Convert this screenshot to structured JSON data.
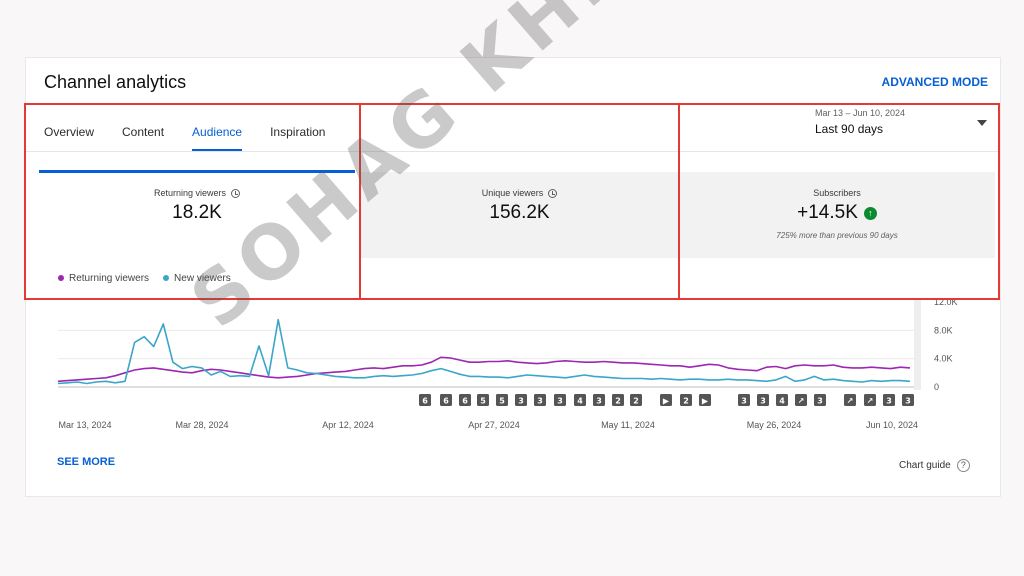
{
  "header": {
    "title": "Channel analytics",
    "advanced_mode": "ADVANCED MODE"
  },
  "tabs": [
    {
      "label": "Overview"
    },
    {
      "label": "Content"
    },
    {
      "label": "Audience",
      "active": true
    },
    {
      "label": "Inspiration"
    }
  ],
  "date_range": {
    "range": "Mar 13 – Jun 10, 2024",
    "label": "Last 90 days"
  },
  "metrics": {
    "returning": {
      "label": "Returning viewers",
      "value": "18.2K"
    },
    "unique": {
      "label": "Unique viewers",
      "value": "156.2K"
    },
    "subscribers": {
      "label": "Subscribers",
      "value": "+14.5K",
      "note": "725% more than previous 90 days"
    }
  },
  "legend": {
    "returning": "Returning viewers",
    "new": "New viewers"
  },
  "colors": {
    "accent": "#065fd4",
    "returning": "#9c27b0",
    "new": "#3aa6c9",
    "highlight": "#e53935",
    "positive": "#0c8a2f"
  },
  "footer": {
    "see_more": "SEE MORE",
    "chart_guide": "Chart guide"
  },
  "watermark": "SOHAG KHISA",
  "chart_data": {
    "type": "line",
    "x_ticks": [
      "Mar 13, 2024",
      "Mar 28, 2024",
      "Apr 12, 2024",
      "Apr 27, 2024",
      "May 11, 2024",
      "May 26, 2024",
      "Jun 10, 2024"
    ],
    "y_ticks": [
      "12.0K",
      "8.0K",
      "4.0K",
      "0"
    ],
    "ylim": [
      0,
      12000
    ],
    "series": [
      {
        "name": "Returning viewers",
        "color": "#9c27b0",
        "values": [
          800,
          900,
          1000,
          1100,
          1200,
          1300,
          1600,
          2000,
          2400,
          2600,
          2700,
          2500,
          2300,
          2100,
          2000,
          2300,
          2500,
          2400,
          2200,
          2000,
          1800,
          1600,
          1400,
          1300,
          1400,
          1500,
          1700,
          1900,
          2000,
          2100,
          2200,
          2400,
          2600,
          2700,
          2600,
          2800,
          3000,
          3000,
          3100,
          3500,
          4200,
          4100,
          3800,
          3500,
          3500,
          3600,
          3600,
          3700,
          3500,
          3400,
          3300,
          3400,
          3600,
          3700,
          3600,
          3500,
          3500,
          3600,
          3500,
          3400,
          3400,
          3300,
          3200,
          3100,
          3000,
          3000,
          2800,
          3000,
          3200,
          3100,
          2700,
          2500,
          2400,
          2300,
          2800,
          2900,
          2600,
          3000,
          3100,
          3000,
          3000,
          3100,
          2800,
          2700,
          2700,
          2800,
          2700,
          2600,
          2800,
          2700
        ]
      },
      {
        "name": "New viewers",
        "color": "#3aa6c9",
        "values": [
          500,
          600,
          700,
          500,
          700,
          800,
          600,
          800,
          6300,
          7100,
          5700,
          8900,
          3500,
          2600,
          2900,
          2700,
          1700,
          2200,
          1500,
          1600,
          1500,
          5800,
          1600,
          9500,
          2700,
          2400,
          2000,
          1900,
          1700,
          1500,
          1400,
          1300,
          1300,
          1500,
          1600,
          1500,
          1600,
          1700,
          1900,
          2300,
          2600,
          2200,
          1800,
          1500,
          1500,
          1400,
          1400,
          1300,
          1500,
          1700,
          1600,
          1500,
          1400,
          1300,
          1500,
          1700,
          1500,
          1400,
          1300,
          1200,
          1200,
          1200,
          1100,
          1200,
          1100,
          1000,
          1100,
          1100,
          1000,
          1000,
          1100,
          1000,
          1000,
          900,
          800,
          1000,
          1500,
          800,
          1000,
          1500,
          1000,
          1100,
          900,
          800,
          700,
          900,
          800,
          900,
          900,
          800
        ]
      }
    ],
    "markers": [
      "6",
      "6",
      "6",
      "5",
      "5",
      "3",
      "3",
      "3",
      "4",
      "3",
      "2",
      "2",
      "▶",
      "2",
      "▶",
      "3",
      "3",
      "4",
      "↗",
      "3",
      "↗",
      "↗",
      "3",
      "3"
    ]
  }
}
